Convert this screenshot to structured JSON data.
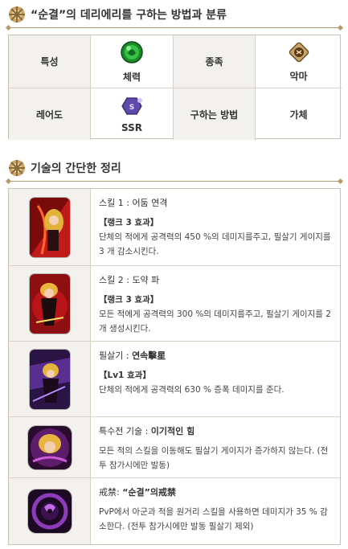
{
  "section1": {
    "title": "“순결”의 데리에리를 구하는 방법과 분류"
  },
  "info": {
    "trait_label": "특성",
    "trait_value": "체력",
    "race_label": "종족",
    "race_value": "악마",
    "rarity_label": "레어도",
    "rarity_value": "SSR",
    "obtain_label": "구하는 방법",
    "obtain_value": "가체",
    "trait_icon": "health-green-orb-icon",
    "race_icon": "demon-race-icon",
    "rarity_icon": "ssr-badge-icon"
  },
  "section2": {
    "title": "기술의 간단한 정리"
  },
  "skills": [
    {
      "name_prefix": "스킬 1 : ",
      "name_main": "어둠 연격",
      "effect": "【랭크 3 효과】",
      "desc": "단체의 적에게 공격력의 450 %의 데미지를주고, 필살기 게이지를 3 개 감소시킨다."
    },
    {
      "name_prefix": "스킬 2 : ",
      "name_main": "도약 파",
      "effect": "【랭크 3 효과】",
      "desc": "모든 적에게 공격력의 300 %의 데미지를주고, 필살기 게이지를 2 개 생성시킨다."
    },
    {
      "name_prefix": "필살기 : ",
      "name_main": "연속擊星",
      "effect": "【Lv1 효과】",
      "desc": "단체의 적에게 공격력의 630 % 증폭 데미지를 준다."
    },
    {
      "name_prefix": "특수전 기술 : ",
      "name_main": "이기적인 힘",
      "effect": "",
      "desc": "모든 적의 스킬을 이동해도 필살기 게이지가 증가하지 않는다. (전투 참가시에만 발동)"
    },
    {
      "name_prefix": "戒禁: ",
      "name_main": "“순결”의戒禁",
      "effect": "",
      "desc": "PvP에서 아군과 적을 원거리 스킬을 사용하면 데미지가 35 % 감소한다. (전투 참가시에만 발동 필살기 제외)"
    }
  ],
  "colors": {
    "accent_gold": "#b89a6a",
    "header_bg": "#f2f1ee",
    "border": "#c9c1b3"
  }
}
